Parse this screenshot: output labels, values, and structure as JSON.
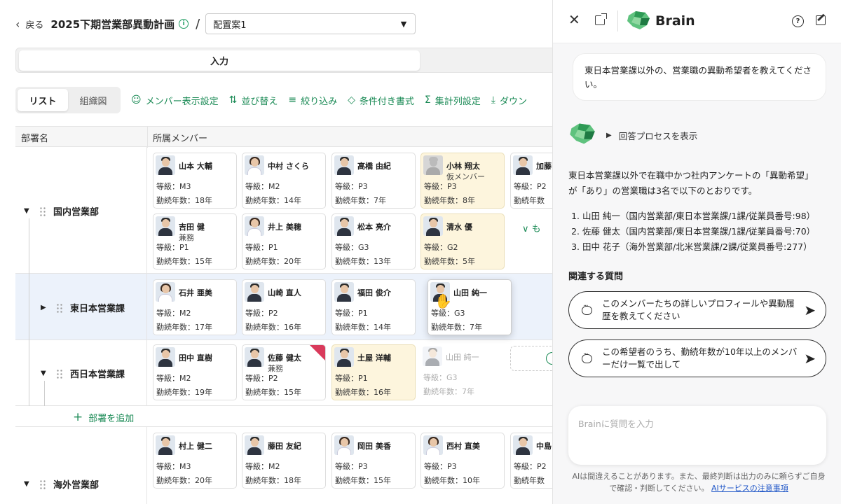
{
  "header": {
    "back_label": "戻る",
    "plan_title": "2025下期営業部異動計画",
    "separator": "/",
    "plan_select_value": "配置案1"
  },
  "mode_tabs": [
    {
      "label": "入力"
    }
  ],
  "view_toggle": {
    "list": "リスト",
    "org": "組織図"
  },
  "toolbar": {
    "member_display": "メンバー表示設定",
    "sort": "並び替え",
    "filter": "絞り込み",
    "conditional_format": "条件付き書式",
    "aggregate": "集計列設定",
    "download": "ダウン"
  },
  "grid": {
    "col_dept": "部署名",
    "col_members": "所属メンバー"
  },
  "departments": [
    {
      "name": "国内営業部",
      "members": [
        {
          "name": "山本 大輔",
          "sub": "",
          "grade": "等級：M3",
          "years": "勤続年数：18年"
        },
        {
          "name": "中村 さくら",
          "sub": "",
          "grade": "等級：M2",
          "years": "勤続年数：14年"
        },
        {
          "name": "高橋 由紀",
          "sub": "",
          "grade": "等級：P3",
          "years": "勤続年数：7年"
        },
        {
          "name": "小林 翔太",
          "sub": "仮メンバー",
          "grade": "等級：P3",
          "years": "勤続年数：8年"
        },
        {
          "name": "加藤",
          "sub": "",
          "grade": "等級：P2",
          "years": "勤続年数"
        },
        {
          "name": "吉田 健",
          "sub": "兼務",
          "grade": "等級：P1",
          "years": "勤続年数：15年"
        },
        {
          "name": "井上 美穂",
          "sub": "",
          "grade": "等級：P1",
          "years": "勤続年数：20年"
        },
        {
          "name": "松本 亮介",
          "sub": "",
          "grade": "等級：G3",
          "years": "勤続年数：13年"
        },
        {
          "name": "清水 優",
          "sub": "",
          "grade": "等級：G2",
          "years": "勤続年数：5年"
        }
      ],
      "more_label": "も"
    },
    {
      "name": "東日本営業課",
      "members": [
        {
          "name": "石井 亜美",
          "sub": "",
          "grade": "等級：M2",
          "years": "勤続年数：17年"
        },
        {
          "name": "山崎 直人",
          "sub": "",
          "grade": "等級：P2",
          "years": "勤続年数：16年"
        },
        {
          "name": "福田 俊介",
          "sub": "",
          "grade": "等級：P1",
          "years": "勤続年数：14年"
        },
        {
          "name": "山田 純一",
          "sub": "",
          "grade": "等級：G3",
          "years": "勤続年数：7年"
        }
      ]
    },
    {
      "name": "西日本営業課",
      "members": [
        {
          "name": "田中 直樹",
          "sub": "",
          "grade": "等級：M2",
          "years": "勤続年数：19年"
        },
        {
          "name": "佐藤 健太",
          "sub": "兼務",
          "grade": "等級：P2",
          "years": "勤続年数：15年"
        },
        {
          "name": "土屋 洋輔",
          "sub": "",
          "grade": "等級：P1",
          "years": "勤続年数：16年"
        },
        {
          "name": "山田 純一",
          "sub": "",
          "grade": "等級：G3",
          "years": "勤続年数：7年"
        }
      ],
      "add_dept_label": "部署を追加"
    },
    {
      "name": "海外営業部",
      "members": [
        {
          "name": "村上 健二",
          "sub": "",
          "grade": "等級：M3",
          "years": "勤続年数：20年"
        },
        {
          "name": "藤田 友紀",
          "sub": "",
          "grade": "等級：M2",
          "years": "勤続年数：18年"
        },
        {
          "name": "岡田 美香",
          "sub": "",
          "grade": "等級：P3",
          "years": "勤続年数：15年"
        },
        {
          "name": "西村 直美",
          "sub": "",
          "grade": "等級：P3",
          "years": "勤続年数：10年"
        },
        {
          "name": "中島",
          "sub": "",
          "grade": "等級：P2",
          "years": "勤続年数"
        }
      ]
    }
  ],
  "panel": {
    "title": "Brain",
    "user_message": "東日本営業課以外の、営業職の異動希望者を教えてください。",
    "process_label": "回答プロセスを表示",
    "answer_intro_1": "東日本営業課以外で在職中かつ社内アンケートの「異動希望」",
    "answer_intro_2": "が「あり」の営業職は3名で以下のとおりです。",
    "answer_items": [
      "山田 純一（国内営業部/東日本営業課/1課/従業員番号:98）",
      "佐藤 健太（国内営業部/東日本営業課/1課/従業員番号:70）",
      "田中 花子（海外営業部/北米営業課/2課/従業員番号:277）"
    ],
    "related_title": "関連する質問",
    "related": [
      "このメンバーたちの詳しいプロフィールや異動履歴を教えてください",
      "この希望者のうち、勤続年数が10年以上のメンバーだけ一覧で出して"
    ],
    "input_placeholder": "Brainに質問を入力",
    "disclaimer": "AIは間違えることがあります。また、最終判断は出力のみに頼らずご自身で確認・判断してください。",
    "disclaimer_link": "AIサービスの注意事項"
  }
}
